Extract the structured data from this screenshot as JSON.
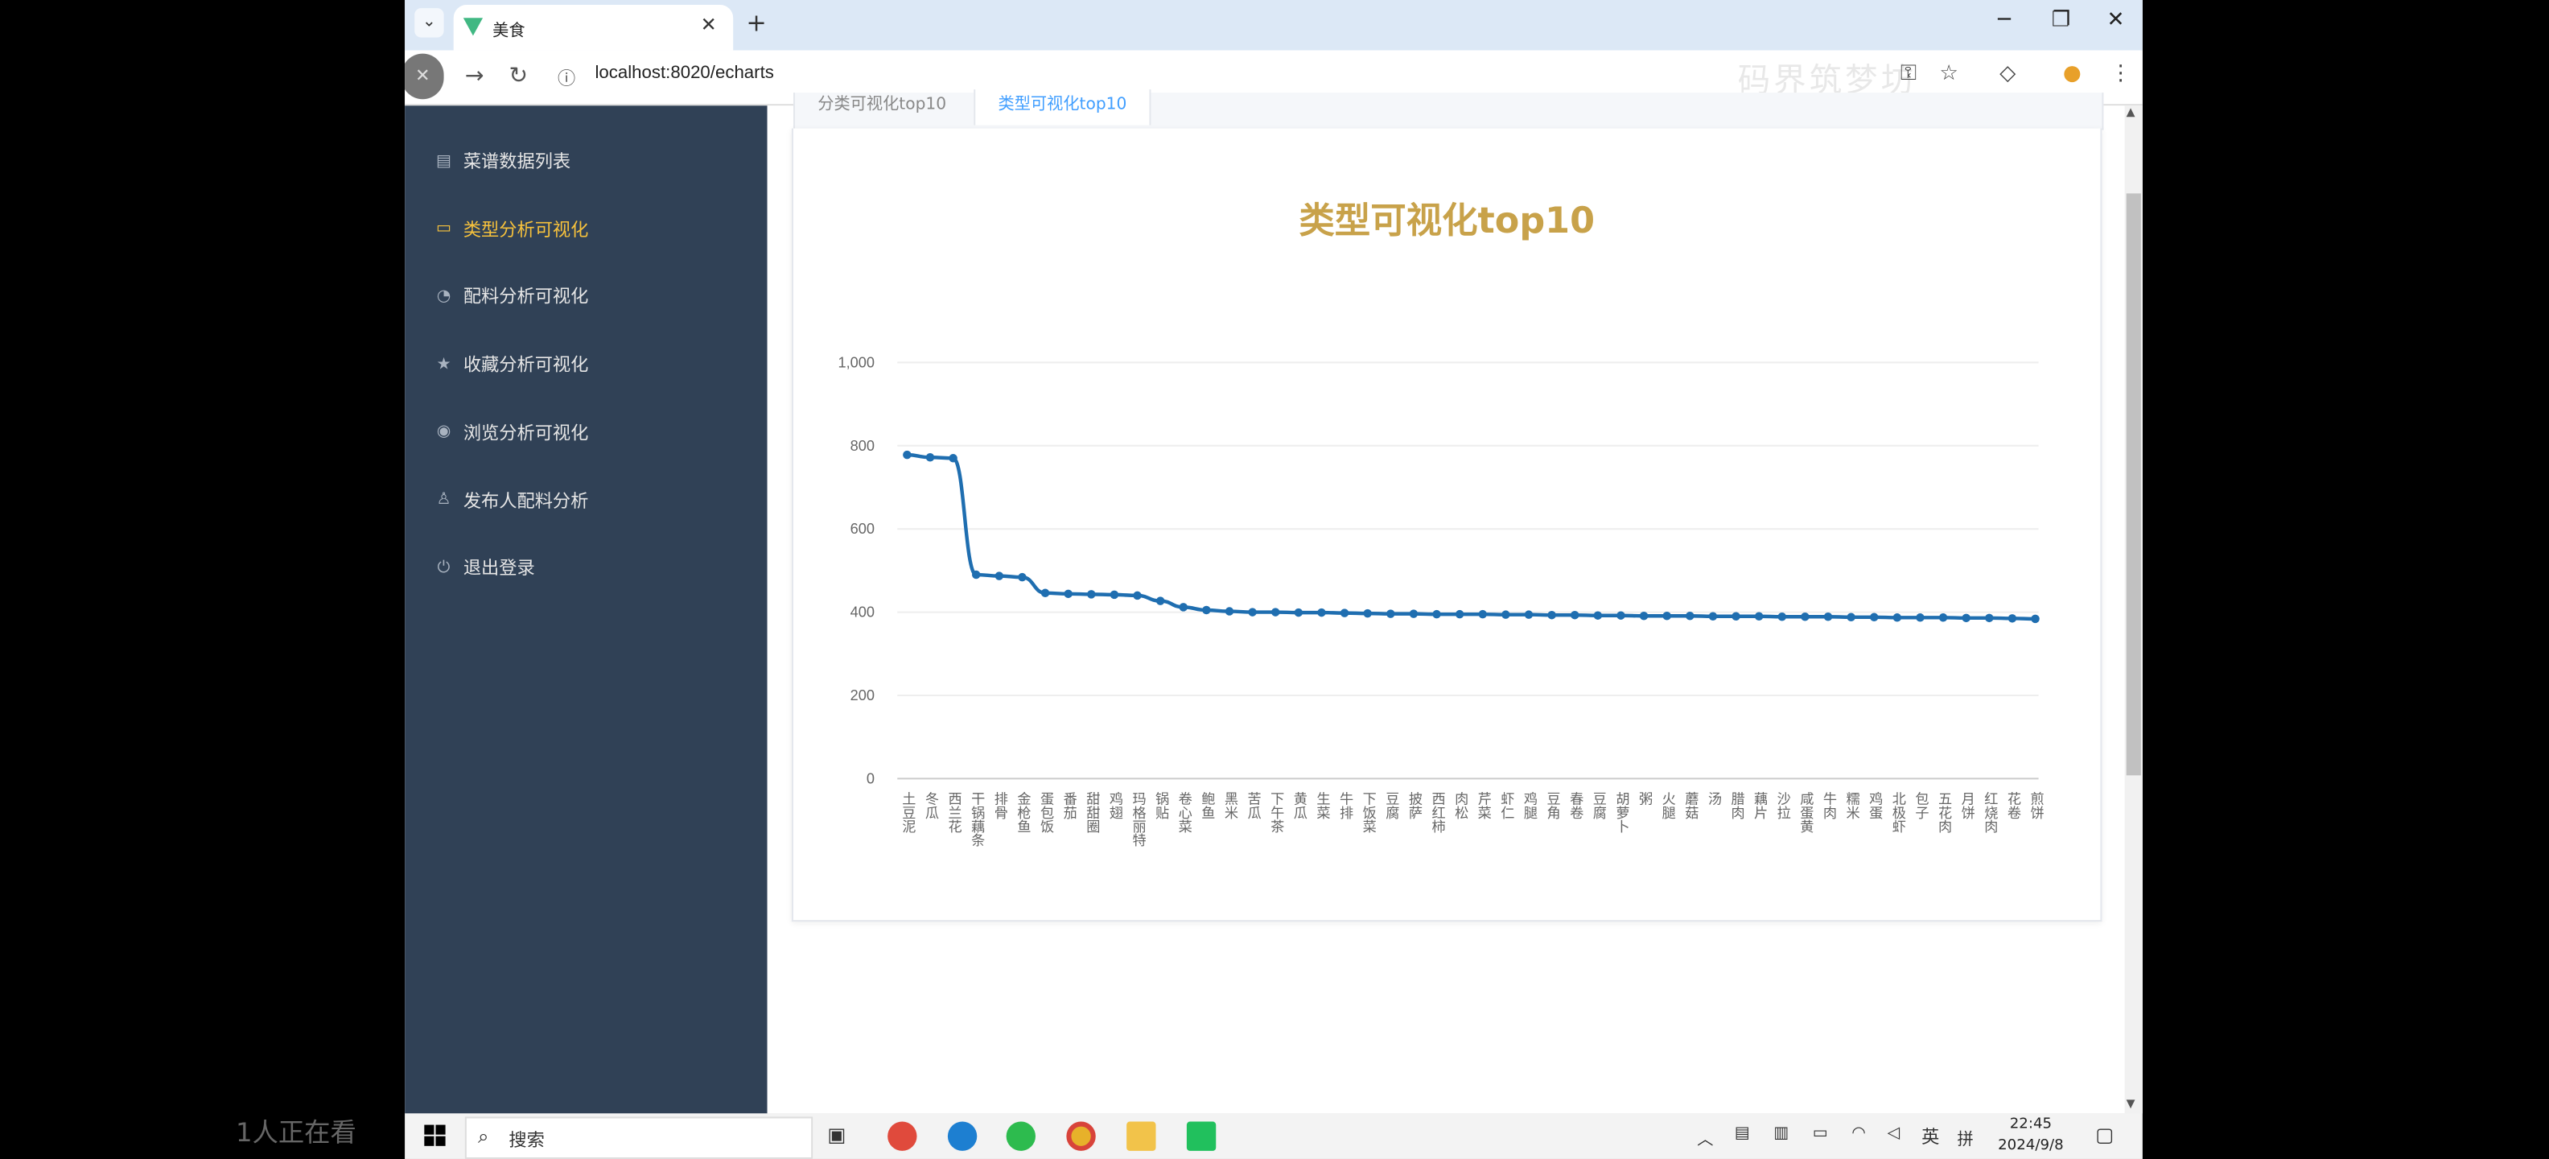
{
  "browser": {
    "tab_title": "美食",
    "url": "localhost:8020/echarts",
    "watermark": "码界筑梦坊",
    "new_tab": "+",
    "tab_close": "✕"
  },
  "sidebar": {
    "items": [
      {
        "label": "菜谱数据列表",
        "icon": "document-icon"
      },
      {
        "label": "类型分析可视化",
        "icon": "chart-board-icon",
        "active": true
      },
      {
        "label": "配料分析可视化",
        "icon": "pie-icon"
      },
      {
        "label": "收藏分析可视化",
        "icon": "star-icon"
      },
      {
        "label": "浏览分析可视化",
        "icon": "eye-icon"
      },
      {
        "label": "发布人配料分析",
        "icon": "user-icon"
      },
      {
        "label": "退出登录",
        "icon": "power-icon"
      }
    ]
  },
  "content_tabs": [
    "分类可视化top10",
    "类型可视化top10"
  ],
  "chart_data": {
    "type": "line",
    "title": "类型可视化top10",
    "ylim": [
      0,
      1000
    ],
    "yticks": [
      "0",
      "200",
      "400",
      "600",
      "800",
      "1,000"
    ],
    "color": "#1f6eb0",
    "title_color": "#c8a24a",
    "categories": [
      "土豆泥",
      "冬瓜",
      "西兰花",
      "干锅藕条",
      "排骨",
      "金枪鱼",
      "蛋包饭",
      "番茄",
      "甜甜圈",
      "鸡翅",
      "玛格丽特",
      "锅贴",
      "卷心菜",
      "鲍鱼",
      "黑米",
      "苦瓜",
      "下午茶",
      "黄瓜",
      "生菜",
      "牛排",
      "下饭菜",
      "豆腐",
      "披萨",
      "西红柿",
      "肉松",
      "芹菜",
      "虾仁",
      "鸡腿",
      "豆角",
      "春卷",
      "豆腐",
      "胡萝卜",
      "粥",
      "火腿",
      "蘑菇",
      "汤",
      "腊肉",
      "藕片",
      "沙拉",
      "咸蛋黄",
      "牛肉",
      "糯米",
      "鸡蛋",
      "北极虾",
      "包子",
      "五花肉",
      "月饼",
      "红烧肉",
      "花卷",
      "煎饼"
    ],
    "values": [
      778,
      772,
      770,
      490,
      487,
      484,
      446,
      444,
      443,
      442,
      440,
      427,
      412,
      405,
      402,
      400,
      400,
      399,
      399,
      398,
      397,
      396,
      396,
      395,
      395,
      395,
      394,
      394,
      393,
      393,
      392,
      392,
      391,
      391,
      391,
      390,
      390,
      390,
      389,
      389,
      389,
      388,
      388,
      387,
      387,
      387,
      386,
      386,
      385,
      384
    ]
  },
  "taskbar": {
    "search_label": "搜索",
    "tray_lang": "英",
    "tray_ime": "拼",
    "time": "22:45",
    "date": "2024/9/8",
    "viewers": "1人正在看"
  }
}
